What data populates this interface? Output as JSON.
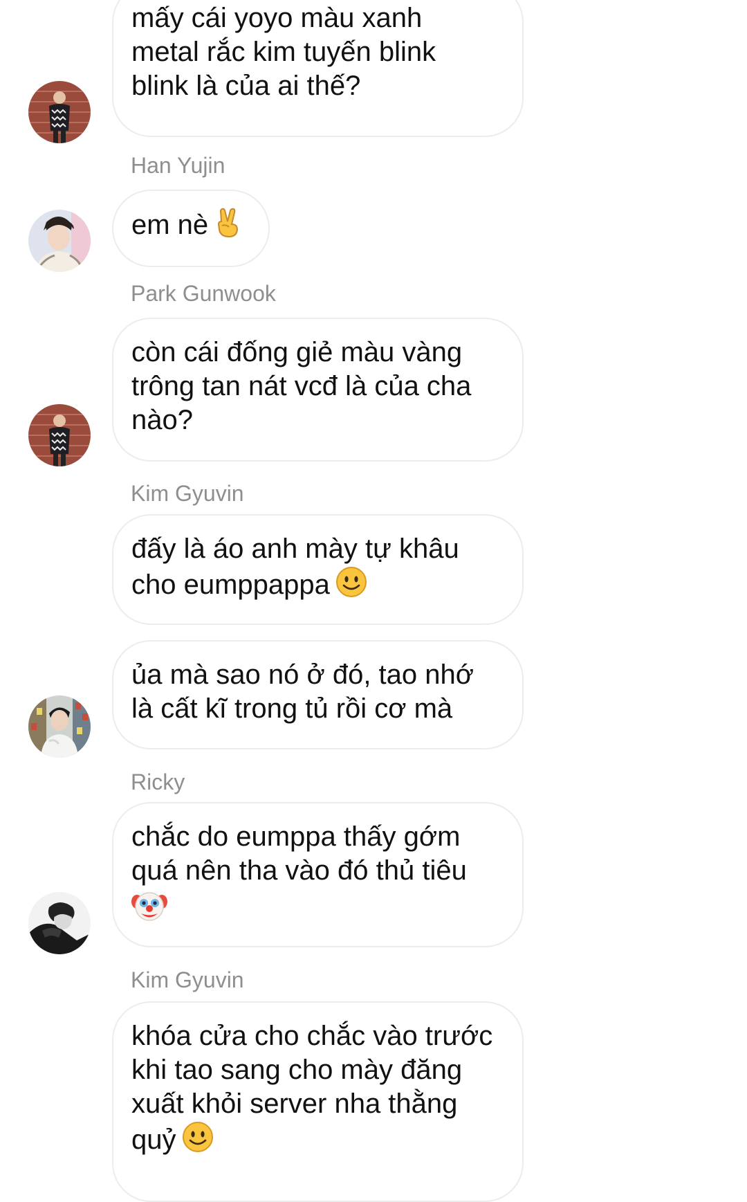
{
  "conversation": {
    "senders": {
      "s1": "Han Yujin",
      "s2": "Park Gunwook",
      "s3": "Kim Gyuvin",
      "s4": "Ricky",
      "s5": "Kim Gyuvin"
    },
    "messages": {
      "m1": "mấy cái yoyo màu xanh\nmetal rắc kim tuyến blink\nblink là của ai thế?",
      "m2": "em nè",
      "m3": "còn cái đống giẻ màu vàng\ntrông tan nát vcđ là của cha\nnào?",
      "m4": "đấy là áo anh mày tự khâu\ncho eumppappa",
      "m5": "ủa mà sao nó ở đó, tao nhớ\nlà cất kĩ trong tủ rồi cơ mà",
      "m6": "chắc do eumppa thấy gớm\nquá nên tha vào đó thủ tiêu",
      "m7": "khóa cửa cho chắc vào trước\nkhi tao sang cho mày đăng\nxuất khỏi server nha thằng\nquỷ"
    },
    "emoji_icons": [
      "victory-hand-icon",
      "smiling-face-icon",
      "clown-face-icon",
      "smiling-face-icon"
    ]
  }
}
